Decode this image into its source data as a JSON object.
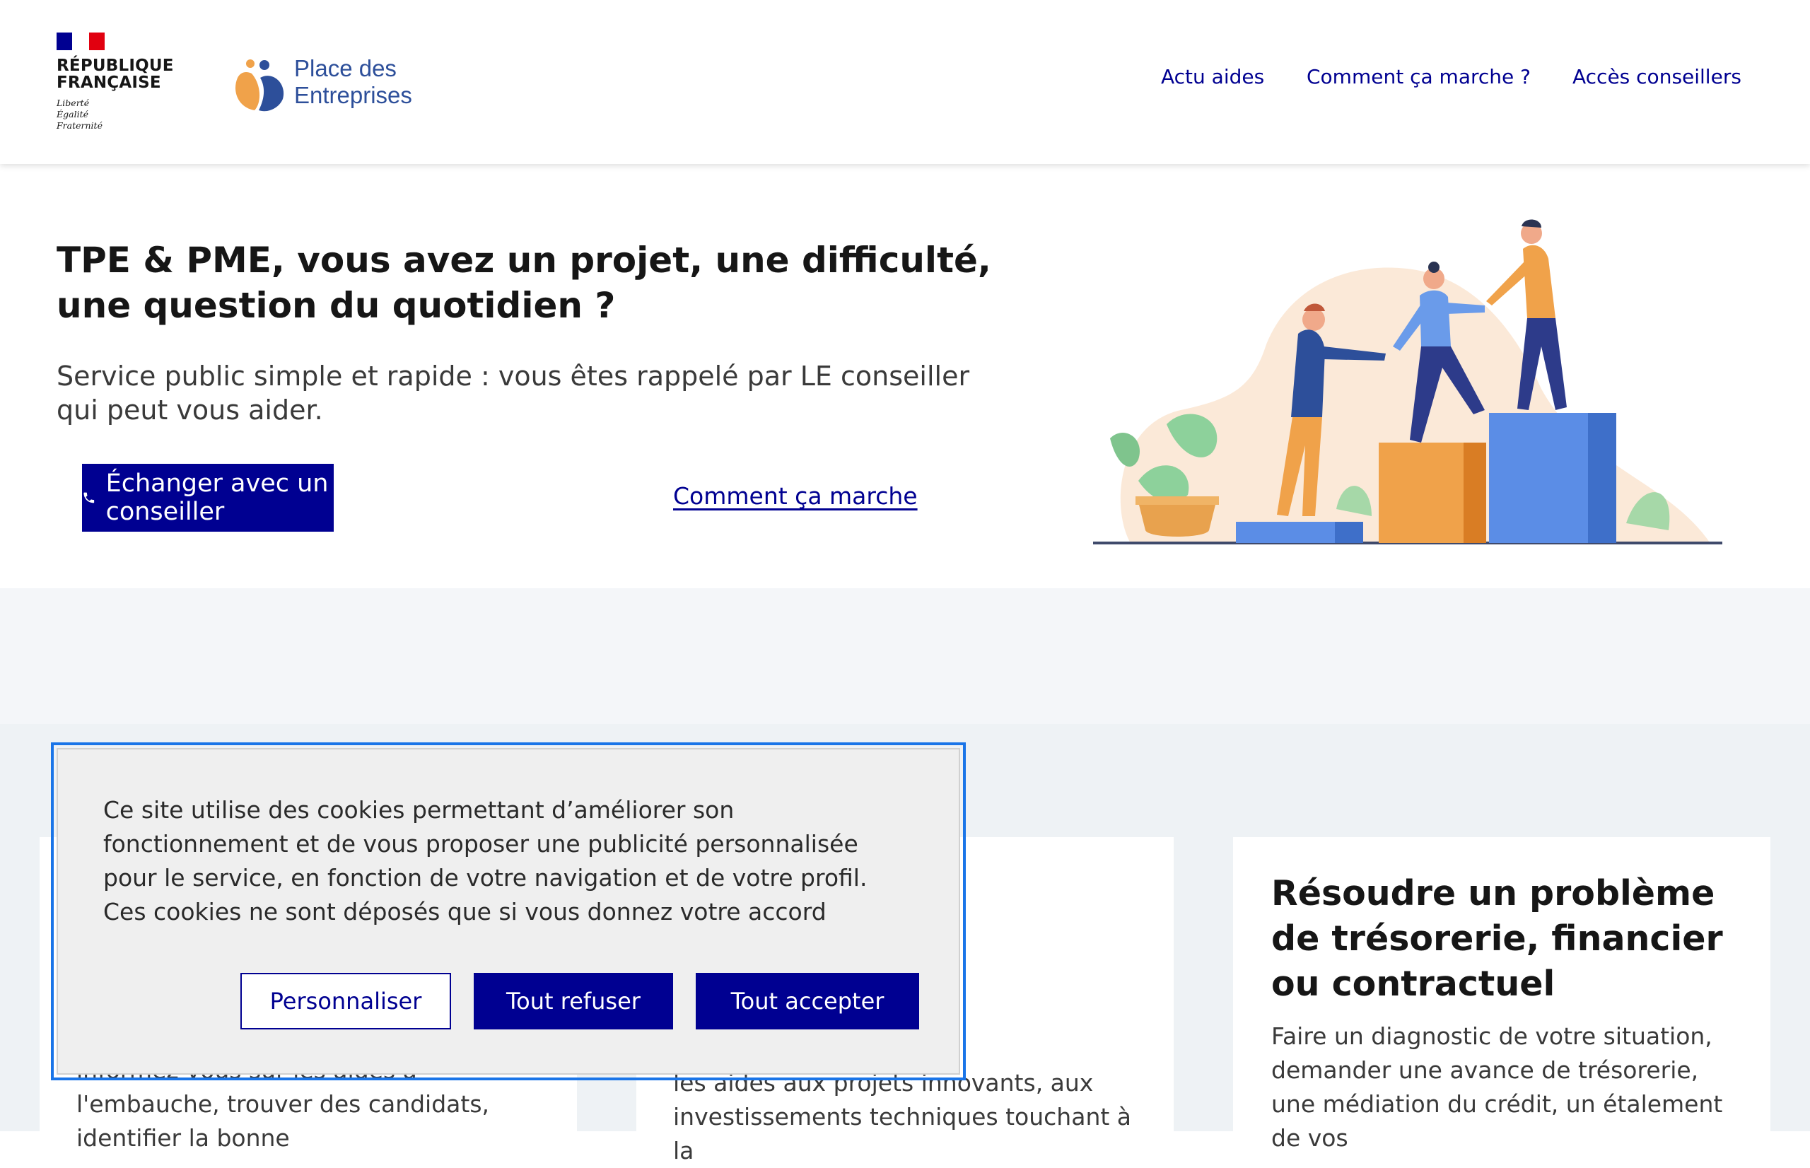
{
  "header": {
    "republic_line1": "RÉPUBLIQUE",
    "republic_line2": "FRANÇAISE",
    "motto": "Liberté\nÉgalité\nFraternité",
    "brand_name": "Place des\nEntreprises",
    "nav": [
      "Actu aides",
      "Comment ça marche ?",
      "Accès conseillers"
    ]
  },
  "hero": {
    "title": "TPE & PME, vous avez un projet, une difficulté, une question du quotidien ?",
    "subtitle": "Service public simple et rapide : vous êtes rappelé par LE conseiller qui peut vous aider.",
    "cta_label": "Échanger avec un conseiller",
    "cta_icon": "phone-icon",
    "secondary_link": "Comment ça marche"
  },
  "cards": [
    {
      "text": "informez-vous sur les aides à l'embauche, trouver des candidats, identifier la bonne"
    },
    {
      "text": "ncières\nes de la Région,\nles aides aux projets innovants, aux\ninvestissements techniques touchant à la"
    },
    {
      "title": "Résoudre un problème de trésorerie, financier ou contractuel",
      "text": "Faire un diagnostic de votre situation, demander une avance de trésorerie, une médiation du crédit, un étalement de vos"
    }
  ],
  "cookie_banner": {
    "message": "Ce site utilise des cookies permettant d’améliorer son fonctionnement et de vous proposer une publicité personnalisée pour le service, en fonction de votre navigation et de votre profil. Ces cookies ne sont déposés que si vous donnez votre accord",
    "customize_label": "Personnaliser",
    "refuse_label": "Tout refuser",
    "accept_label": "Tout accepter"
  },
  "colors": {
    "primary": "#000091",
    "brand_blue": "#2d4f9a",
    "brand_orange": "#f0a24a",
    "focus": "#1a75e8"
  }
}
